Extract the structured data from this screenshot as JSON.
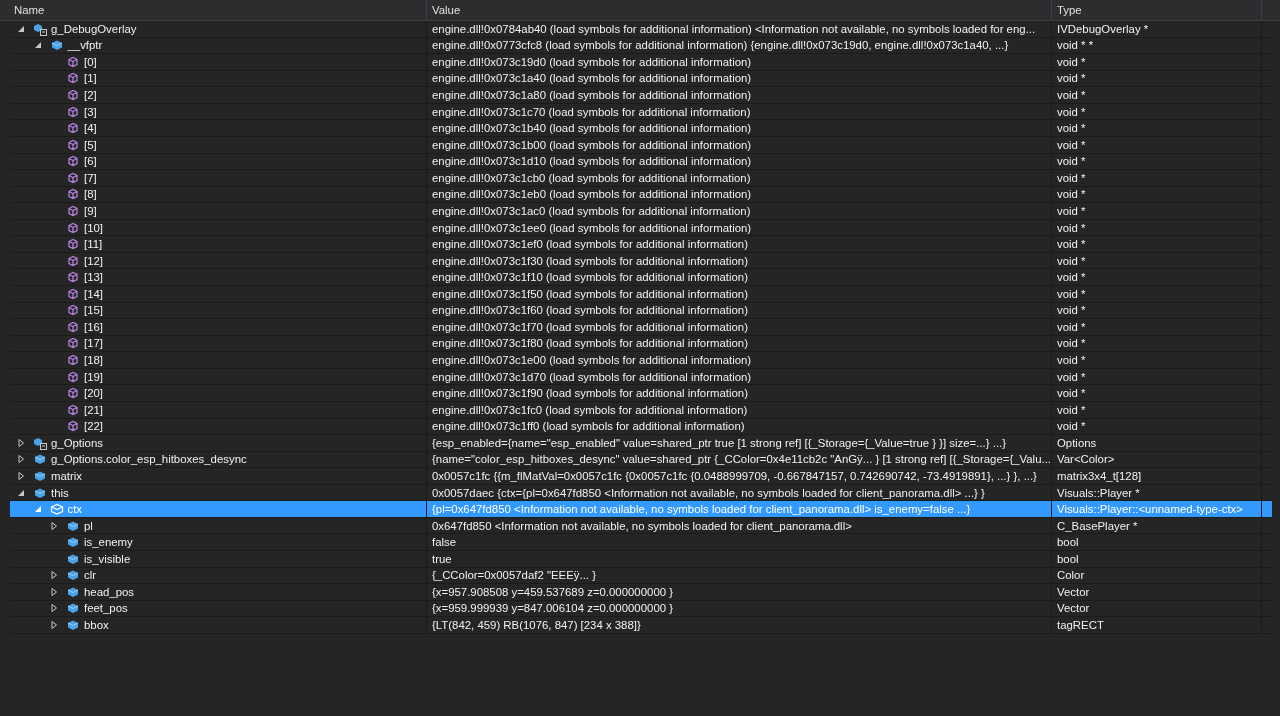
{
  "columns": [
    "Name",
    "Value",
    "Type"
  ],
  "rows": [
    {
      "name": "g_DebugOverlay",
      "value": "engine.dll!0x0784ab40 (load symbols for additional information) <Information not available, no symbols loaded for eng...",
      "type": "IVDebugOverlay *",
      "kind": "global",
      "expanded": true,
      "selected": false,
      "children": [
        {
          "name": "__vfptr",
          "value": "engine.dll!0x0773cfc8 (load symbols for additional information) {engine.dll!0x073c19d0, engine.dll!0x073c1a40, ...}",
          "type": "void * *",
          "kind": "field",
          "expanded": true,
          "selected": false,
          "children": [
            {
              "name": "[0]",
              "value": "engine.dll!0x073c19d0 (load symbols for additional information)",
              "type": "void *",
              "kind": "vfunc",
              "selected": false
            },
            {
              "name": "[1]",
              "value": "engine.dll!0x073c1a40 (load symbols for additional information)",
              "type": "void *",
              "kind": "vfunc",
              "selected": false
            },
            {
              "name": "[2]",
              "value": "engine.dll!0x073c1a80 (load symbols for additional information)",
              "type": "void *",
              "kind": "vfunc",
              "selected": false
            },
            {
              "name": "[3]",
              "value": "engine.dll!0x073c1c70 (load symbols for additional information)",
              "type": "void *",
              "kind": "vfunc",
              "selected": false
            },
            {
              "name": "[4]",
              "value": "engine.dll!0x073c1b40 (load symbols for additional information)",
              "type": "void *",
              "kind": "vfunc",
              "selected": false
            },
            {
              "name": "[5]",
              "value": "engine.dll!0x073c1b00 (load symbols for additional information)",
              "type": "void *",
              "kind": "vfunc",
              "selected": false
            },
            {
              "name": "[6]",
              "value": "engine.dll!0x073c1d10 (load symbols for additional information)",
              "type": "void *",
              "kind": "vfunc",
              "selected": false
            },
            {
              "name": "[7]",
              "value": "engine.dll!0x073c1cb0 (load symbols for additional information)",
              "type": "void *",
              "kind": "vfunc",
              "selected": false
            },
            {
              "name": "[8]",
              "value": "engine.dll!0x073c1eb0 (load symbols for additional information)",
              "type": "void *",
              "kind": "vfunc",
              "selected": false
            },
            {
              "name": "[9]",
              "value": "engine.dll!0x073c1ac0 (load symbols for additional information)",
              "type": "void *",
              "kind": "vfunc",
              "selected": false
            },
            {
              "name": "[10]",
              "value": "engine.dll!0x073c1ee0 (load symbols for additional information)",
              "type": "void *",
              "kind": "vfunc",
              "selected": false
            },
            {
              "name": "[11]",
              "value": "engine.dll!0x073c1ef0 (load symbols for additional information)",
              "type": "void *",
              "kind": "vfunc",
              "selected": false
            },
            {
              "name": "[12]",
              "value": "engine.dll!0x073c1f30 (load symbols for additional information)",
              "type": "void *",
              "kind": "vfunc",
              "selected": false
            },
            {
              "name": "[13]",
              "value": "engine.dll!0x073c1f10 (load symbols for additional information)",
              "type": "void *",
              "kind": "vfunc",
              "selected": false
            },
            {
              "name": "[14]",
              "value": "engine.dll!0x073c1f50 (load symbols for additional information)",
              "type": "void *",
              "kind": "vfunc",
              "selected": false
            },
            {
              "name": "[15]",
              "value": "engine.dll!0x073c1f60 (load symbols for additional information)",
              "type": "void *",
              "kind": "vfunc",
              "selected": false
            },
            {
              "name": "[16]",
              "value": "engine.dll!0x073c1f70 (load symbols for additional information)",
              "type": "void *",
              "kind": "vfunc",
              "selected": false
            },
            {
              "name": "[17]",
              "value": "engine.dll!0x073c1f80 (load symbols for additional information)",
              "type": "void *",
              "kind": "vfunc",
              "selected": false
            },
            {
              "name": "[18]",
              "value": "engine.dll!0x073c1e00 (load symbols for additional information)",
              "type": "void *",
              "kind": "vfunc",
              "selected": false
            },
            {
              "name": "[19]",
              "value": "engine.dll!0x073c1d70 (load symbols for additional information)",
              "type": "void *",
              "kind": "vfunc",
              "selected": false
            },
            {
              "name": "[20]",
              "value": "engine.dll!0x073c1f90 (load symbols for additional information)",
              "type": "void *",
              "kind": "vfunc",
              "selected": false
            },
            {
              "name": "[21]",
              "value": "engine.dll!0x073c1fc0 (load symbols for additional information)",
              "type": "void *",
              "kind": "vfunc",
              "selected": false
            },
            {
              "name": "[22]",
              "value": "engine.dll!0x073c1ff0 (load symbols for additional information)",
              "type": "void *",
              "kind": "vfunc",
              "selected": false
            }
          ]
        }
      ]
    },
    {
      "name": "g_Options",
      "value": "{esp_enabled={name=\"esp_enabled\" value=shared_ptr true [1 strong ref] [{_Storage={_Value=true } }] size=...} ...}",
      "type": "Options",
      "kind": "global",
      "expanded": false,
      "selected": false
    },
    {
      "name": "g_Options.color_esp_hitboxes_desync",
      "value": "{name=\"color_esp_hitboxes_desync\" value=shared_ptr {_CColor=0x4e11cb2c \"AnGÿ... } [1 strong ref] [{_Storage={_Valu...",
      "type": "Var<Color>",
      "kind": "field",
      "expanded": false,
      "selected": false
    },
    {
      "name": "matrix",
      "value": "0x0057c1fc {{m_flMatVal=0x0057c1fc {0x0057c1fc {0.0488999709, -0.667847157, 0.742690742, -73.4919891}, ...} }, ...}",
      "type": "matrix3x4_t[128]",
      "kind": "field",
      "expanded": false,
      "selected": false
    },
    {
      "name": "this",
      "value": "0x0057daec {ctx={pl=0x647fd850 <Information not available, no symbols loaded for client_panorama.dll> ...} }",
      "type": "Visuals::Player *",
      "kind": "field",
      "expanded": true,
      "selected": false,
      "children": [
        {
          "name": "ctx",
          "value": "{pl=0x647fd850 <Information not available, no symbols loaded for client_panorama.dll> is_enemy=false ...}",
          "type": "Visuals::Player::<unnamed-type-ctx>",
          "kind": "struct",
          "expanded": true,
          "selected": true,
          "children": [
            {
              "name": "pl",
              "value": "0x647fd850 <Information not available, no symbols loaded for client_panorama.dll>",
              "type": "C_BasePlayer *",
              "kind": "field",
              "expanded": false,
              "selected": false
            },
            {
              "name": "is_enemy",
              "value": "false",
              "type": "bool",
              "kind": "field",
              "selected": false
            },
            {
              "name": "is_visible",
              "value": "true",
              "type": "bool",
              "kind": "field",
              "selected": false
            },
            {
              "name": "clr",
              "value": "{_CColor=0x0057daf2 \"EEEÿ... }",
              "type": "Color",
              "kind": "field",
              "expanded": false,
              "selected": false
            },
            {
              "name": "head_pos",
              "value": "{x=957.908508 y=459.537689 z=0.000000000 }",
              "type": "Vector",
              "kind": "field",
              "expanded": false,
              "selected": false
            },
            {
              "name": "feet_pos",
              "value": "{x=959.999939 y=847.006104 z=0.000000000 }",
              "type": "Vector",
              "kind": "field",
              "expanded": false,
              "selected": false
            },
            {
              "name": "bbox",
              "value": "{LT(842, 459) RB(1076, 847)  [234 x 388]}",
              "type": "tagRECT",
              "kind": "field",
              "expanded": false,
              "selected": false
            }
          ]
        }
      ]
    }
  ]
}
